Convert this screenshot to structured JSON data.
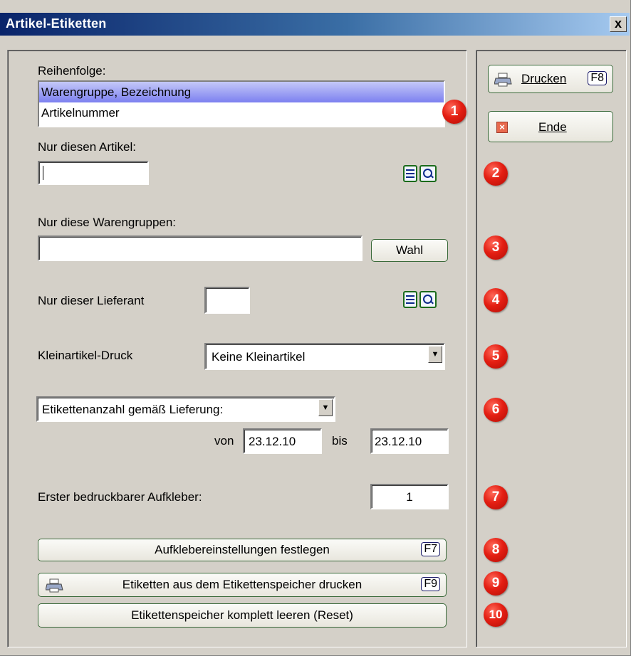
{
  "window": {
    "title": "Artikel-Etiketten",
    "close_label": "x"
  },
  "sort": {
    "label": "Reihenfolge:",
    "items": [
      "Warengruppe, Bezeichnung",
      "Artikelnummer"
    ]
  },
  "article": {
    "label": "Nur diesen Artikel:",
    "value": ""
  },
  "groups": {
    "label": "Nur diese Warengruppen:",
    "value": "",
    "button": "Wahl"
  },
  "supplier": {
    "label": "Nur dieser Lieferant",
    "value": ""
  },
  "small_print": {
    "label": "Kleinartikel-Druck",
    "value": "Keine Kleinartikel"
  },
  "label_count": {
    "value": "Etikettenanzahl gemäß Lieferung:",
    "from_label": "von",
    "from": "23.12.10",
    "to_label": "bis",
    "to": "23.12.10"
  },
  "first_sticker": {
    "label": "Erster bedruckbarer Aufkleber:",
    "value": "1"
  },
  "buttons": {
    "settings": "Aufklebereinstellungen festlegen",
    "settings_key": "F7",
    "print_store": "Etiketten aus dem Etikettenspeicher drucken",
    "print_store_key": "F9",
    "reset": "Etikettenspeicher komplett leeren (Reset)"
  },
  "side": {
    "print_label": "Drucken",
    "print_key": "F8",
    "end_label": "Ende"
  },
  "badges": [
    "1",
    "2",
    "3",
    "4",
    "5",
    "6",
    "7",
    "8",
    "9",
    "10"
  ],
  "colors": {
    "title_start": "#0a246a",
    "title_end": "#a6caf0",
    "badge": "#e41f13",
    "button_border": "#3a6a3a"
  }
}
